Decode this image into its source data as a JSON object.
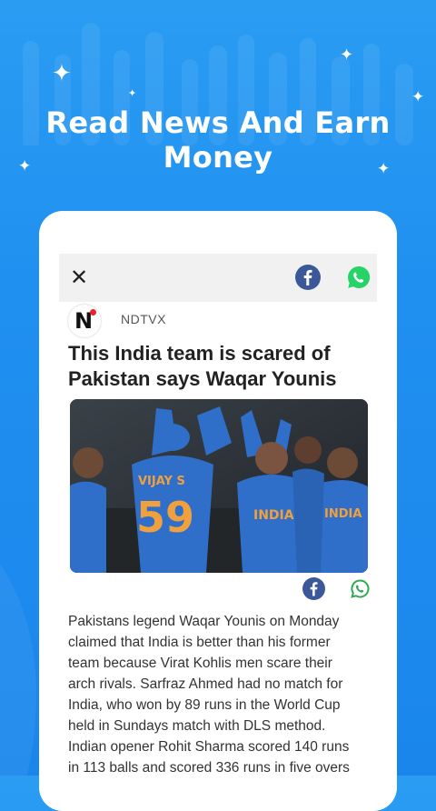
{
  "banner": {
    "headline": "Read News And Earn Money"
  },
  "article_header": {
    "close_icon": "close-icon",
    "share_icons": [
      "facebook-icon",
      "whatsapp-icon"
    ]
  },
  "source": {
    "name": "NDTVX",
    "logo_letter": "N"
  },
  "article": {
    "title": "This India team is scared of Pakistan  says Waqar Younis",
    "image": {
      "jersey_name": "VIJAY S",
      "jersey_number": "59",
      "jersey_text": "INDIA",
      "jersey_text_2": "INDIA"
    },
    "body": "Pakistans legend Waqar Younis on Monday claimed that India is better than his former team because Virat Kohlis men scare their arch rivals. Sarfraz Ahmed had no match for India, who won by 89 runs in the World Cup held in Sundays match with DLS method. Indian opener Rohit Sharma scored 140 runs in 113 balls and scored 336 runs in five overs"
  },
  "colors": {
    "background": "#1f8ff0",
    "facebook": "#3b5998",
    "whatsapp": "#25d366",
    "jersey": "#2f6fc9"
  }
}
